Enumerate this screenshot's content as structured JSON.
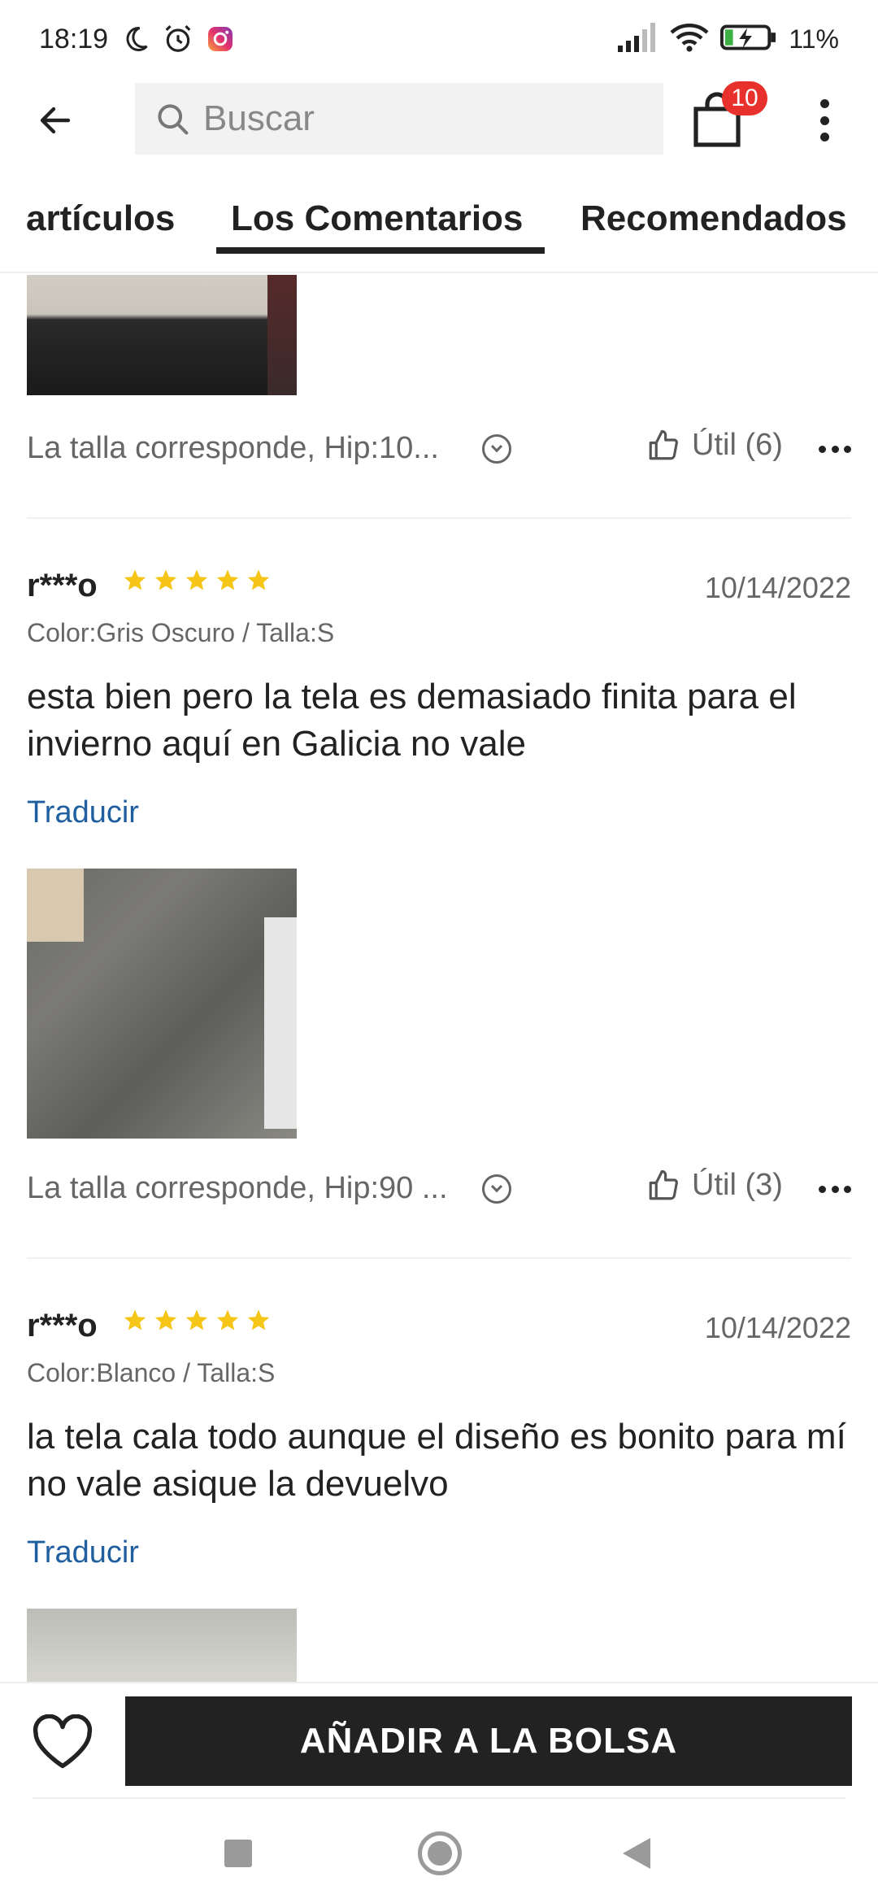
{
  "status_bar": {
    "time": "18:19",
    "battery": "11%"
  },
  "header": {
    "search_placeholder": "Buscar",
    "cart_count": "10"
  },
  "tabs": [
    {
      "label": "artículos"
    },
    {
      "label": "Los Comentarios",
      "active": true
    },
    {
      "label": "Recomendados"
    }
  ],
  "reviews": [
    {
      "size_info": "La talla corresponde, Hip:10...",
      "helpful": "Útil (6)"
    },
    {
      "user": "r***o",
      "rating": 5,
      "date": "10/14/2022",
      "variant": "Color:Gris Oscuro / Talla:S",
      "text": "esta bien pero la tela es demasiado finita para el invierno aquí en Galicia no vale",
      "translate": "Traducir",
      "size_info": "La talla corresponde, Hip:90 ...",
      "helpful": "Útil (3)"
    },
    {
      "user": "r***o",
      "rating": 5,
      "date": "10/14/2022",
      "variant": "Color:Blanco / Talla:S",
      "text": "la tela cala todo aunque el diseño es bonito para mí no vale asique la devuelvo",
      "translate": "Traducir"
    }
  ],
  "bottom_bar": {
    "add_to_bag": "AÑADIR A LA BOLSA"
  },
  "colors": {
    "accent": "#222222",
    "badge": "#e8312c",
    "link": "#1f5fa0",
    "star": "#f5c518"
  }
}
